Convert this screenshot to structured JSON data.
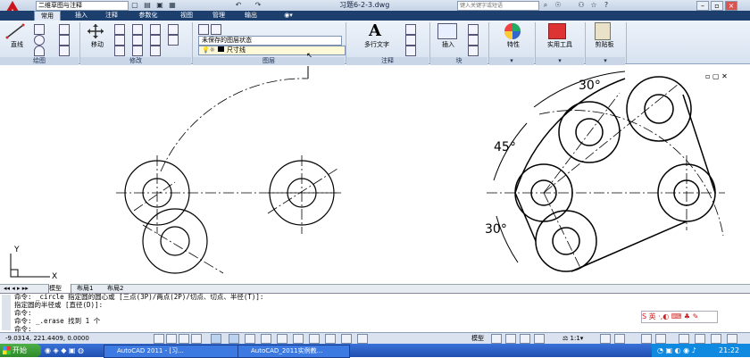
{
  "titlebar": {
    "workspace": "二维草图与注释",
    "doc_title": "习题6-2-3.dwg",
    "search_placeholder": "键入关键字或短语",
    "quick_access_icons": [
      "new-icon",
      "open-icon",
      "save-icon",
      "undo-icon",
      "redo-icon",
      "print-icon"
    ]
  },
  "tabs": [
    "常用",
    "插入",
    "注释",
    "参数化",
    "视图",
    "管理",
    "输出"
  ],
  "active_tab": "常用",
  "ribbon": {
    "draw": {
      "line": "直线",
      "panel": "绘图"
    },
    "modify": {
      "move": "移动",
      "panel": "修改"
    },
    "layers": {
      "state": "未保存的图层状态",
      "current_layer": "尺寸线",
      "panel": "图层"
    },
    "annotation": {
      "mtext": "多行文字",
      "panel": "注释"
    },
    "block": {
      "insert": "插入",
      "panel": "块"
    },
    "properties": {
      "label": "特性"
    },
    "utilities": {
      "label": "实用工具"
    },
    "clipboard": {
      "label": "剪贴板"
    }
  },
  "drawing": {
    "dims": [
      "30°",
      "45°",
      "30°"
    ],
    "ucs_x": "X",
    "ucs_y": "Y"
  },
  "layout_tabs": [
    "模型",
    "布局1",
    "布局2"
  ],
  "command": {
    "lines": [
      "命令: _circle 指定圆的圆心或 [三点(3P)/两点(2P)/切点、切点、半径(T)]:",
      "指定圆的半径或 [直径(D)]:",
      "命令:",
      "命令: _.erase 找到 1 个",
      "命令:"
    ]
  },
  "status": {
    "coords": "-9.0314,   221.4409, 0.0000",
    "model": "模型",
    "scale": "1:1"
  },
  "taskbar": {
    "start": "开始",
    "tasks": [
      "AutoCAD 2011 - [习...",
      "AutoCAD_2011实例教..."
    ],
    "time": "21:22"
  },
  "colors": {
    "tab_bar": "#1d3f6e",
    "taskbar": "#245edb",
    "start": "#3a9a36",
    "ribbon": "#dfe8f4"
  }
}
